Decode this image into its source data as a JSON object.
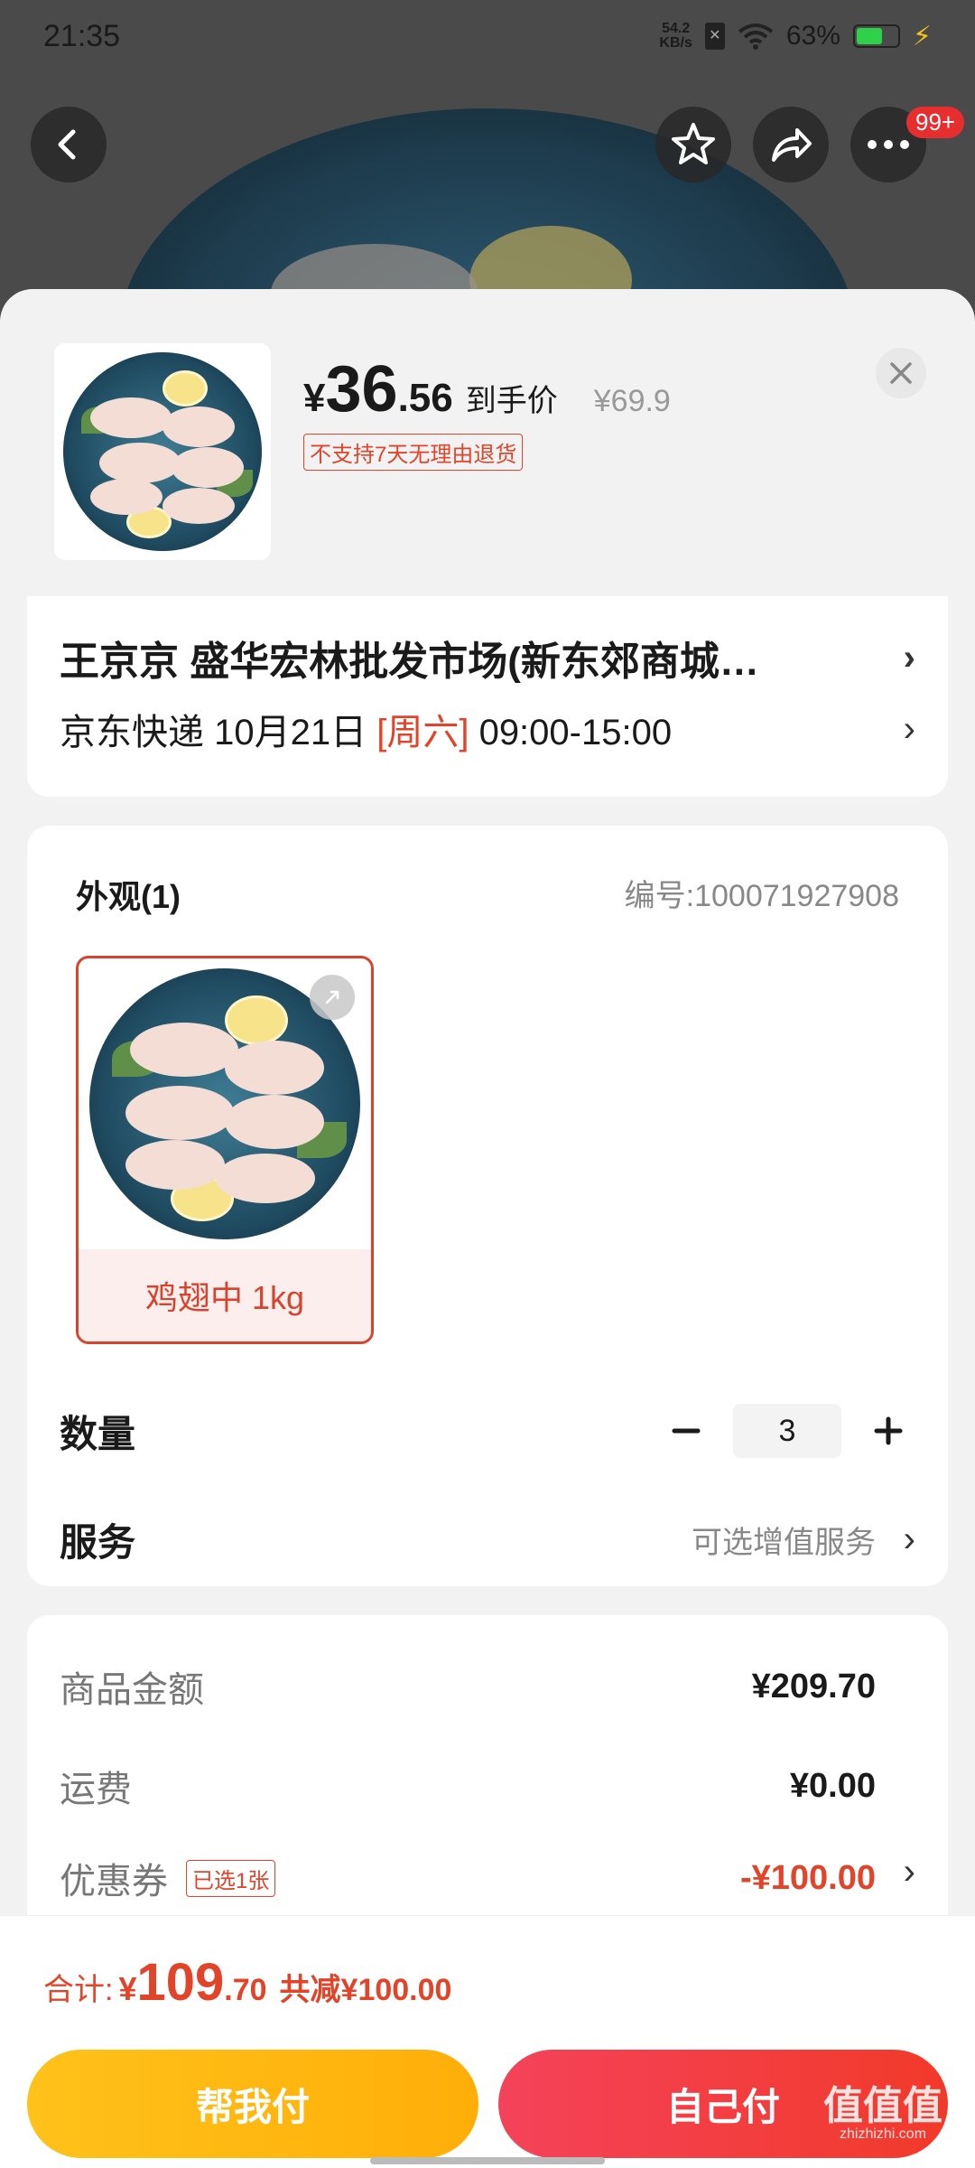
{
  "status": {
    "time": "21:35",
    "net_speed_value": "54.2",
    "net_speed_unit": "KB/s",
    "battery": "63%"
  },
  "nav": {
    "badge": "99+"
  },
  "product": {
    "price_yen": "¥",
    "price_int": "36",
    "price_dec": ".56",
    "price_label": "到手价",
    "original_price": "¥69.9",
    "return_tag": "不支持7天无理由退货"
  },
  "address": {
    "line": "王京京  盛华宏林批发市场(新东郊商城…",
    "carrier": "京东快递 10月21日 ",
    "weekday": "[周六]",
    "time_window": " 09:00-15:00"
  },
  "sku": {
    "title": "外观(1)",
    "code": "编号:100071927908",
    "option_label": "鸡翅中 1kg"
  },
  "quantity": {
    "label": "数量",
    "value": "3"
  },
  "service": {
    "label": "服务",
    "value": "可选增值服务"
  },
  "summary": {
    "goods_label": "商品金额",
    "goods_value": "¥209.70",
    "shipping_label": "运费",
    "shipping_value": "¥0.00",
    "coupon_label": "优惠券",
    "coupon_tag": "已选1张",
    "coupon_value": "-¥100.00"
  },
  "bottom": {
    "total_label": "合计:",
    "total_yen": "¥",
    "total_int": "109",
    "total_dec": ".70",
    "discount": "共减¥100.00",
    "help_pay": "帮我付",
    "self_pay": "自己付"
  },
  "watermark": {
    "main": "值值值",
    "sub": "zhizhizhi.com"
  },
  "colors": {
    "accent_red": "#e2442a",
    "help_yellow": "#ffc21a",
    "self_red": "#f4425a"
  }
}
